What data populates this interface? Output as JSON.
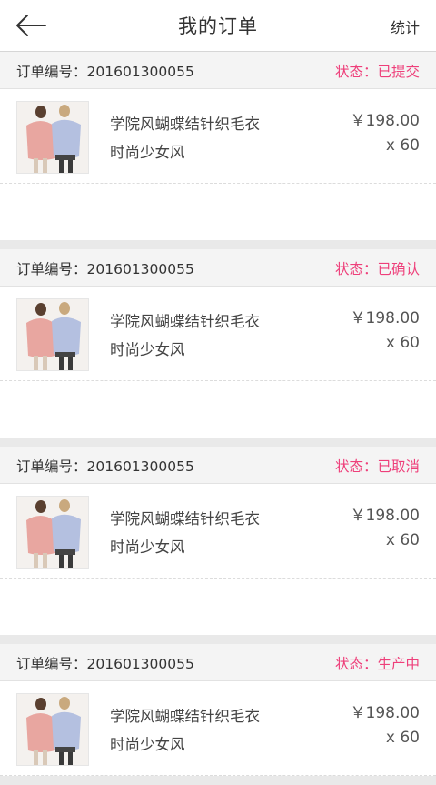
{
  "header": {
    "title": "我的订单",
    "stats_label": "统计",
    "back_icon": "back-arrow-icon"
  },
  "colors": {
    "status": "#ee3f7a",
    "header_bg": "#f4f4f4",
    "page_bg": "#e9e9e9"
  },
  "orders": [
    {
      "order_no_label": "订单编号：201601300055",
      "status_label": "状态：已提交",
      "item": {
        "name": "学院风蝴蝶结针织毛衣",
        "style": "时尚少女风",
        "price": "￥198.00",
        "qty": "x 60"
      }
    },
    {
      "order_no_label": "订单编号：201601300055",
      "status_label": "状态：已确认",
      "item": {
        "name": "学院风蝴蝶结针织毛衣",
        "style": "时尚少女风",
        "price": "￥198.00",
        "qty": "x 60"
      }
    },
    {
      "order_no_label": "订单编号：201601300055",
      "status_label": "状态：已取消",
      "item": {
        "name": "学院风蝴蝶结针织毛衣",
        "style": "时尚少女风",
        "price": "￥198.00",
        "qty": "x 60"
      }
    },
    {
      "order_no_label": "订单编号：201601300055",
      "status_label": "状态：生产中",
      "item": {
        "name": "学院风蝴蝶结针织毛衣",
        "style": "时尚少女风",
        "price": "￥198.00",
        "qty": "x 60"
      }
    }
  ]
}
